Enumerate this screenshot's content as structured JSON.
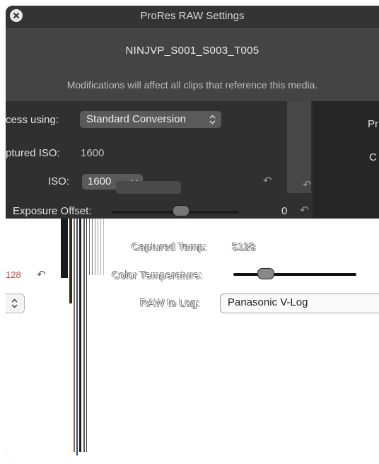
{
  "window": {
    "title": "ProRes RAW Settings",
    "clip_name": "NINJVP_S001_S003_T005",
    "subtitle": "Modifications will affect all clips that reference this media."
  },
  "settings": {
    "process_label": "cess using:",
    "process_value": "Standard Conversion",
    "captured_iso_label": "ptured ISO:",
    "captured_iso_value": "1600",
    "iso_label": "ISO:",
    "iso_value": "1600",
    "exposure_label": "Exposure Offset:",
    "exposure_value": "0",
    "exposure_level": 0.5,
    "right_cut_1": "Pr",
    "right_cut_2": "C"
  },
  "lower": {
    "captured_temp_label": "Captured Temp:",
    "captured_temp_value": "5128",
    "color_temp_label": "Color Temperature:",
    "color_temp_level": 0.25,
    "left_value": "128",
    "raw_to_log_label": "RAW to Log:",
    "raw_to_log_value": "Panasonic V-Log"
  },
  "icons": {
    "close": "close-icon",
    "popup_arrows": "updown-chevron-icon",
    "reset": "reset-arrow-icon"
  },
  "colors": {
    "window_bg": "#3a3a3a",
    "header_bg": "#444444",
    "panel_bg": "#303030",
    "popup_bg": "#5a5a5a"
  }
}
